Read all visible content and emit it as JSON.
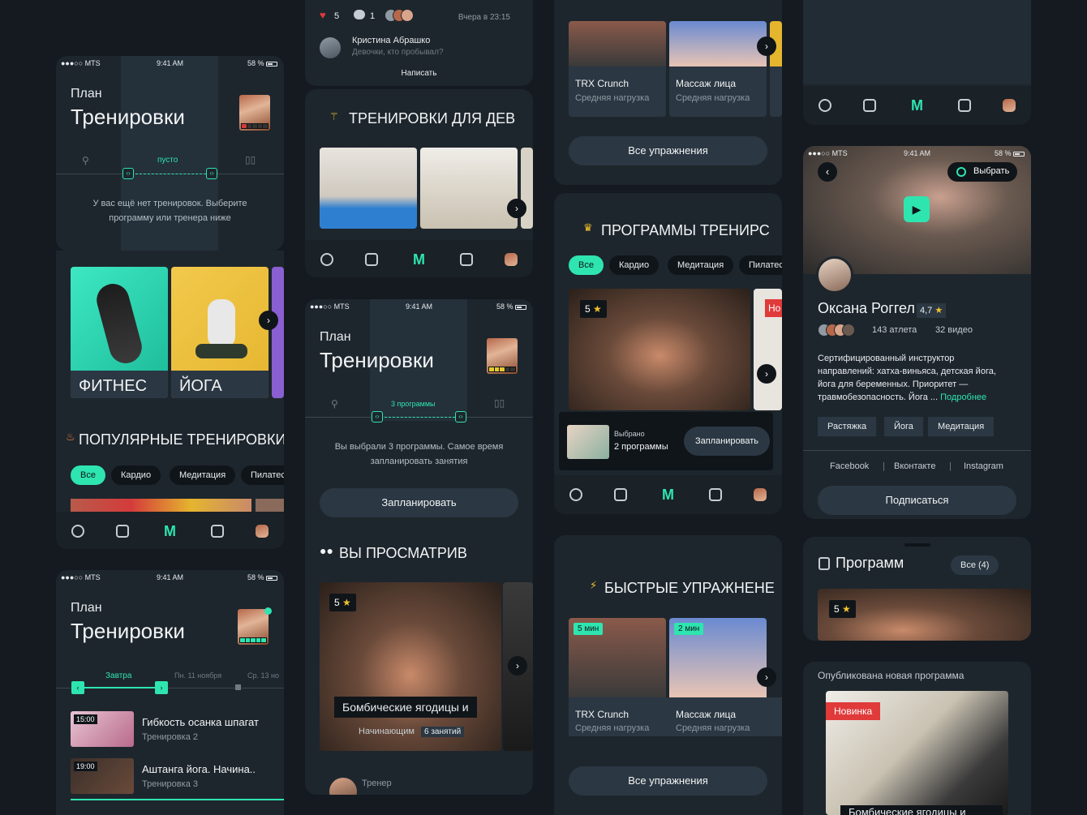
{
  "status": {
    "carrier": "●●●○○ MTS",
    "time": "9:41 AM",
    "battery": "58 %"
  },
  "plan": {
    "small": "План",
    "large": "Тренировки"
  },
  "col1": {
    "empty_label": "пусто",
    "empty_msg_1": "У вас ещё нет тренировок. Выберите",
    "empty_msg_2": "программу или тренера ниже",
    "cat1": "ФИТНЕС",
    "cat2": "ЙОГА",
    "popular_title": "ПОПУЛЯРНЫЕ ТРЕНИРОВКИ",
    "chips": [
      "Все",
      "Кардио",
      "Медитация",
      "Пилатес"
    ],
    "tomorrow": "Завтра",
    "date2": "Пн. 11 ноября",
    "date3": "Ср. 13 но",
    "workouts": [
      {
        "time": "15:00",
        "title": "Гибкость осанка шпагат",
        "sub": "Тренировка 2"
      },
      {
        "time": "19:00",
        "title": "Аштанга йога. Начина..",
        "sub": "Тренировка 3"
      }
    ]
  },
  "col2": {
    "likes": "5",
    "comments": "1",
    "when": "Вчера в 23:15",
    "author": "Кристина Абрашко",
    "comment": "Девочки, кто пробывал?",
    "write": "Написать",
    "girls_title": "ТРЕНИРОВКИ ДЛЯ ДЕВ",
    "chosen_label": "3 программы",
    "chosen_msg_1": "Вы выбрали 3 программы. Самое время",
    "chosen_msg_2": "запланировать занятия",
    "plan_btn": "Запланировать",
    "viewed_title": "ВЫ ПРОСМАТРИВ",
    "rating": "5",
    "course_title": "Бомбические ягодицы и",
    "level": "Начинающим",
    "lessons": "6 занятий",
    "trainer": "Тренер"
  },
  "col3": {
    "ex": [
      {
        "title": "TRX Crunch",
        "sub": "Средняя нагрузка",
        "min": "5 мин"
      },
      {
        "title": "Массаж лица",
        "sub": "Средняя нагрузка",
        "min": "2 мин"
      }
    ],
    "all_ex": "Все упражнения",
    "programs_title": "ПРОГРАММЫ ТРЕНИРС",
    "chips": [
      "Все",
      "Кардио",
      "Медитация",
      "Пилатес"
    ],
    "rating": "5",
    "new_tag": "Но",
    "selected_label": "Выбрано",
    "selected_val": "2 программы",
    "plan_btn": "Запланировать",
    "quick_title": "БЫСТРЫЕ УПРАЖНЕНЕ"
  },
  "col4": {
    "choose": "Выбрать",
    "name": "Оксана Роггел",
    "score": "4,7",
    "athletes": "143 атлета",
    "videos": "32 видео",
    "bio_1": "Сертифицированный инструктор",
    "bio_2": "направлений: хатха-виньяса, детская йога,",
    "bio_3": "йога для беременных. Приоритет —",
    "bio_4": "травмобезопасность. Йога ...",
    "more": "Подробнее",
    "tags": [
      "Растяжка",
      "Йога",
      "Медитация"
    ],
    "socials": [
      "Facebook",
      "Вконтакте",
      "Instagram"
    ],
    "subscribe": "Подписаться",
    "programs": "Программ",
    "all_count": "Все (4)",
    "rating": "5",
    "published": "Опубликована новая программа",
    "new": "Новинка",
    "course": "Бомбические ягодицы и"
  },
  "colors": {
    "accent": "#2ee5b0",
    "bg": "#141a20",
    "card": "#1e262d",
    "red": "#e03a3a"
  }
}
